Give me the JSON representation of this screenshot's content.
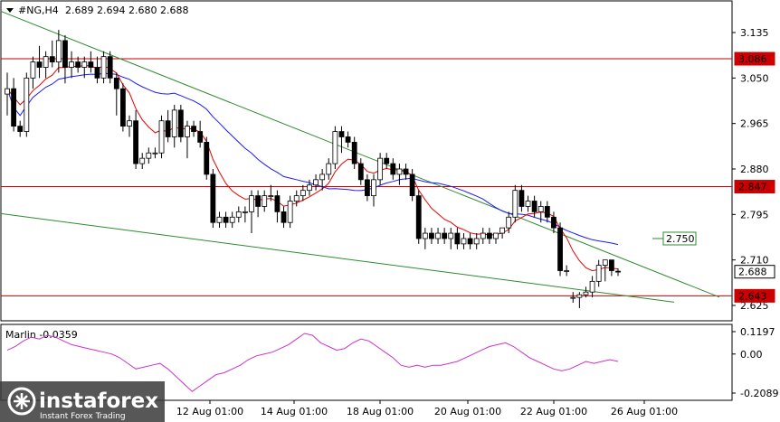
{
  "header": {
    "symbol": "#NG,H4",
    "ohlc": "2.689 2.694 2.680 2.688"
  },
  "indicator": {
    "name": "Marlin",
    "value": "-0.0359",
    "label": "Marlin -0.0359",
    "axis_ticks": [
      "0.1197",
      "0.00",
      "-0.2089"
    ]
  },
  "price_axis": {
    "ticks": [
      "3.135",
      "3.050",
      "2.965",
      "2.880",
      "2.795",
      "2.710",
      "2.625"
    ]
  },
  "price_labels": {
    "level_high": "3.086",
    "level_mid": "2.847",
    "level_low": "2.643",
    "current": "2.688",
    "channel_target": "2.750"
  },
  "time_axis": {
    "labels": [
      "12 Aug 01:00",
      "14 Aug 01:00",
      "18 Aug 01:00",
      "20 Aug 01:00",
      "22 Aug 01:00",
      "26 Aug 01:00"
    ]
  },
  "watermark": {
    "brand": "instaforex",
    "tagline": "Instant Forex Trading"
  },
  "colors": {
    "bull": "#ffffff",
    "bear": "#000000",
    "level_lines": "#cc0000",
    "channel": "#2e8b2e",
    "ma_fast": "#e60000",
    "ma_slow": "#1a1aff",
    "oscillator": "#cc33cc"
  },
  "chart_data": {
    "type": "candlestick",
    "title": "#NG,H4",
    "ylim": [
      2.6,
      3.19
    ],
    "horizontal_levels": [
      3.086,
      2.847,
      2.643
    ],
    "channel_projection_label": 2.75,
    "last_price": 2.688,
    "candles": [
      [
        3.02,
        3.06,
        2.98,
        3.03
      ],
      [
        3.03,
        3.05,
        2.95,
        2.96
      ],
      [
        2.96,
        2.97,
        2.94,
        2.95
      ],
      [
        2.95,
        3.06,
        2.94,
        3.05
      ],
      [
        3.05,
        3.09,
        3.03,
        3.08
      ],
      [
        3.08,
        3.11,
        3.05,
        3.07
      ],
      [
        3.07,
        3.1,
        3.05,
        3.09
      ],
      [
        3.09,
        3.12,
        3.07,
        3.08
      ],
      [
        3.08,
        3.14,
        3.06,
        3.12
      ],
      [
        3.12,
        3.13,
        3.04,
        3.07
      ],
      [
        3.07,
        3.1,
        3.05,
        3.08
      ],
      [
        3.08,
        3.09,
        3.06,
        3.07
      ],
      [
        3.07,
        3.09,
        3.05,
        3.08
      ],
      [
        3.08,
        3.1,
        3.06,
        3.07
      ],
      [
        3.07,
        3.09,
        3.04,
        3.05
      ],
      [
        3.05,
        3.1,
        3.04,
        3.09
      ],
      [
        3.09,
        3.1,
        3.04,
        3.05
      ],
      [
        3.05,
        3.06,
        2.98,
        3.03
      ],
      [
        3.03,
        3.04,
        2.95,
        2.96
      ],
      [
        2.96,
        2.98,
        2.94,
        2.97
      ],
      [
        2.97,
        2.99,
        2.88,
        2.89
      ],
      [
        2.89,
        2.91,
        2.88,
        2.9
      ],
      [
        2.9,
        2.92,
        2.89,
        2.91
      ],
      [
        2.91,
        2.92,
        2.9,
        2.91
      ],
      [
        2.91,
        2.98,
        2.9,
        2.97
      ],
      [
        2.97,
        2.99,
        2.93,
        2.94
      ],
      [
        2.94,
        3.0,
        2.92,
        2.99
      ],
      [
        2.99,
        3.0,
        2.93,
        2.94
      ],
      [
        2.94,
        2.97,
        2.9,
        2.96
      ],
      [
        2.96,
        2.97,
        2.94,
        2.95
      ],
      [
        2.95,
        2.97,
        2.92,
        2.93
      ],
      [
        2.93,
        2.94,
        2.86,
        2.87
      ],
      [
        2.87,
        2.88,
        2.77,
        2.78
      ],
      [
        2.78,
        2.8,
        2.77,
        2.79
      ],
      [
        2.79,
        2.8,
        2.77,
        2.78
      ],
      [
        2.78,
        2.8,
        2.77,
        2.79
      ],
      [
        2.79,
        2.81,
        2.78,
        2.8
      ],
      [
        2.8,
        2.81,
        2.78,
        2.8
      ],
      [
        2.8,
        2.84,
        2.76,
        2.83
      ],
      [
        2.83,
        2.84,
        2.79,
        2.81
      ],
      [
        2.81,
        2.84,
        2.8,
        2.83
      ],
      [
        2.83,
        2.85,
        2.82,
        2.83
      ],
      [
        2.83,
        2.84,
        2.78,
        2.8
      ],
      [
        2.8,
        2.81,
        2.77,
        2.78
      ],
      [
        2.78,
        2.83,
        2.77,
        2.82
      ],
      [
        2.82,
        2.84,
        2.81,
        2.83
      ],
      [
        2.83,
        2.85,
        2.82,
        2.84
      ],
      [
        2.84,
        2.86,
        2.83,
        2.85
      ],
      [
        2.85,
        2.87,
        2.84,
        2.86
      ],
      [
        2.86,
        2.88,
        2.84,
        2.87
      ],
      [
        2.87,
        2.9,
        2.86,
        2.89
      ],
      [
        2.89,
        2.96,
        2.88,
        2.95
      ],
      [
        2.95,
        2.96,
        2.91,
        2.94
      ],
      [
        2.94,
        2.95,
        2.92,
        2.93
      ],
      [
        2.93,
        2.94,
        2.88,
        2.89
      ],
      [
        2.89,
        2.9,
        2.85,
        2.86
      ],
      [
        2.86,
        2.87,
        2.82,
        2.83
      ],
      [
        2.83,
        2.87,
        2.81,
        2.86
      ],
      [
        2.86,
        2.91,
        2.85,
        2.9
      ],
      [
        2.9,
        2.91,
        2.88,
        2.89
      ],
      [
        2.89,
        2.9,
        2.86,
        2.87
      ],
      [
        2.87,
        2.89,
        2.85,
        2.88
      ],
      [
        2.88,
        2.89,
        2.86,
        2.87
      ],
      [
        2.87,
        2.88,
        2.82,
        2.83
      ],
      [
        2.83,
        2.84,
        2.74,
        2.75
      ],
      [
        2.75,
        2.77,
        2.73,
        2.76
      ],
      [
        2.76,
        2.77,
        2.74,
        2.75
      ],
      [
        2.75,
        2.77,
        2.74,
        2.76
      ],
      [
        2.76,
        2.77,
        2.74,
        2.75
      ],
      [
        2.75,
        2.77,
        2.73,
        2.76
      ],
      [
        2.76,
        2.77,
        2.73,
        2.74
      ],
      [
        2.74,
        2.76,
        2.73,
        2.75
      ],
      [
        2.75,
        2.76,
        2.73,
        2.74
      ],
      [
        2.74,
        2.76,
        2.73,
        2.75
      ],
      [
        2.75,
        2.77,
        2.74,
        2.76
      ],
      [
        2.76,
        2.77,
        2.74,
        2.75
      ],
      [
        2.75,
        2.76,
        2.74,
        2.76
      ],
      [
        2.76,
        2.77,
        2.75,
        2.77
      ],
      [
        2.77,
        2.8,
        2.76,
        2.79
      ],
      [
        2.79,
        2.85,
        2.78,
        2.84
      ],
      [
        2.84,
        2.85,
        2.8,
        2.81
      ],
      [
        2.81,
        2.83,
        2.8,
        2.82
      ],
      [
        2.82,
        2.83,
        2.79,
        2.8
      ],
      [
        2.8,
        2.82,
        2.78,
        2.81
      ],
      [
        2.81,
        2.82,
        2.78,
        2.79
      ],
      [
        2.79,
        2.8,
        2.76,
        2.77
      ],
      [
        2.77,
        2.78,
        2.68,
        2.69
      ],
      [
        2.69,
        2.7,
        2.68,
        2.69
      ],
      [
        2.64,
        2.65,
        2.63,
        2.64
      ],
      [
        2.64,
        2.65,
        2.62,
        2.645
      ],
      [
        2.645,
        2.66,
        2.64,
        2.65
      ],
      [
        2.65,
        2.68,
        2.64,
        2.67
      ],
      [
        2.67,
        2.71,
        2.66,
        2.7
      ],
      [
        2.7,
        2.71,
        2.67,
        2.71
      ],
      [
        2.71,
        2.71,
        2.68,
        2.69
      ],
      [
        2.689,
        2.694,
        2.68,
        2.688
      ]
    ],
    "indicator_series": {
      "name": "Marlin",
      "ylim": [
        -0.2089,
        0.1197
      ],
      "values": [
        0.02,
        0.04,
        0.07,
        0.09,
        0.08,
        0.1,
        0.09,
        0.07,
        0.05,
        0.04,
        0.03,
        0.02,
        0.01,
        0.0,
        -0.02,
        -0.05,
        -0.08,
        -0.07,
        -0.06,
        -0.05,
        -0.08,
        -0.12,
        -0.16,
        -0.2,
        -0.17,
        -0.14,
        -0.11,
        -0.1,
        -0.08,
        -0.06,
        -0.03,
        -0.01,
        0.0,
        0.01,
        0.03,
        0.05,
        0.08,
        0.11,
        0.1,
        0.06,
        0.04,
        0.02,
        0.03,
        0.06,
        0.08,
        0.07,
        0.04,
        0.01,
        -0.02,
        -0.06,
        -0.07,
        -0.06,
        -0.07,
        -0.06,
        -0.06,
        -0.05,
        -0.04,
        -0.02,
        0.0,
        0.02,
        0.04,
        0.05,
        0.06,
        0.04,
        0.01,
        -0.02,
        -0.04,
        -0.06,
        -0.08,
        -0.09,
        -0.08,
        -0.06,
        -0.04,
        -0.05,
        -0.04,
        -0.03,
        -0.04
      ]
    }
  }
}
